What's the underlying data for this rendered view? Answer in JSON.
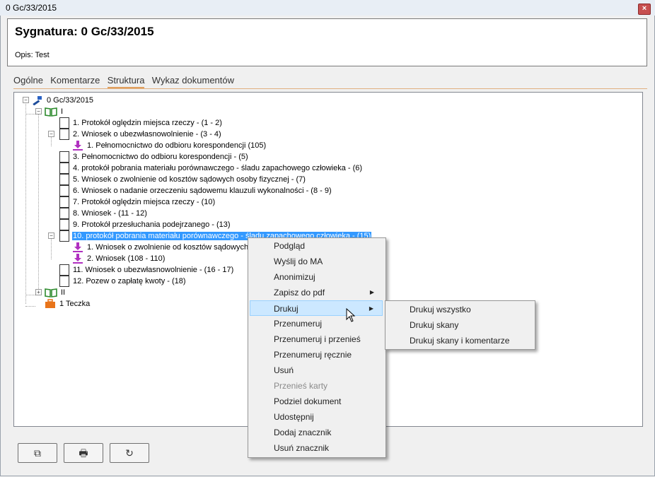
{
  "window": {
    "title": "0 Gc/33/2015",
    "close_label": "×"
  },
  "header": {
    "signature": "Sygnatura: 0 Gc/33/2015",
    "description": "Opis: Test"
  },
  "tabs": [
    {
      "label": "Ogólne"
    },
    {
      "label": "Komentarze"
    },
    {
      "label": "Struktura"
    },
    {
      "label": "Wykaz dokumentów"
    }
  ],
  "active_tab": "Struktura",
  "tree": {
    "root": "0 Gc/33/2015",
    "nodes": [
      {
        "text": "I"
      },
      {
        "text": "1. Protokół oględzin miejsca rzeczy -  (1 - 2)"
      },
      {
        "text": "2. Wniosek o ubezwłasnowolnienie -  (3 - 4)"
      },
      {
        "text": "1. Pełnomocnictwo do odbioru korespondencji (105)"
      },
      {
        "text": "3. Pełnomocnictwo do odbioru korespondencji -  (5)"
      },
      {
        "text": "4. protokół pobrania materiału porównawczego - śladu zapachowego człowieka -  (6)"
      },
      {
        "text": "5. Wniosek o zwolnienie od kosztów sądowych osoby fizycznej -  (7)"
      },
      {
        "text": "6. Wniosek o nadanie orzeczeniu sądowemu klauzuli wykonalności -  (8 - 9)"
      },
      {
        "text": "7. Protokół oględzin miejsca rzeczy -  (10)"
      },
      {
        "text": "8. Wniosek -  (11 - 12)"
      },
      {
        "text": "9. Protokół przesłuchania podejrzanego -  (13)"
      },
      {
        "text": "10. protokół pobrania materiału porównawczego - śladu zapachowego człowieka -  (15)"
      },
      {
        "text": "1. Wniosek o zwolnienie od kosztów sądowych osoby fizycznej"
      },
      {
        "text": "2. Wniosek (108 - 110)"
      },
      {
        "text": "11. Wniosek o ubezwłasnowolnienie -  (16 - 17)"
      },
      {
        "text": "12. Pozew o zapłatę kwoty -  (18)"
      },
      {
        "text": "II"
      },
      {
        "text": "1 Teczka"
      }
    ]
  },
  "context_menu": {
    "items": [
      {
        "label": "Podgląd"
      },
      {
        "label": "Wyślij do MA"
      },
      {
        "label": "Anonimizuj"
      },
      {
        "label": "Zapisz do pdf",
        "submenu": true
      },
      {
        "label": "Drukuj",
        "submenu": true,
        "highlighted": true
      },
      {
        "label": "Przenumeruj"
      },
      {
        "label": "Przenumeruj i przenieś"
      },
      {
        "label": "Przenumeruj ręcznie"
      },
      {
        "label": "Usuń"
      },
      {
        "label": "Przenieś karty",
        "disabled": true
      },
      {
        "label": "Podziel dokument"
      },
      {
        "label": "Udostępnij"
      },
      {
        "label": "Dodaj znacznik"
      },
      {
        "label": "Usuń znacznik"
      }
    ]
  },
  "submenu": {
    "items": [
      {
        "label": "Drukuj wszystko"
      },
      {
        "label": "Drukuj skany"
      },
      {
        "label": "Drukuj skany i komentarze"
      }
    ]
  },
  "bottom_buttons": [
    {
      "icon": "copy-icon",
      "glyph": "⧉"
    },
    {
      "icon": "print-icon",
      "glyph": "🖶"
    },
    {
      "icon": "refresh-icon",
      "glyph": "↻"
    }
  ],
  "colors": {
    "selection": "#3399ff",
    "menu_highlight": "#cce8ff",
    "book_green": "#2e8b2e",
    "download_purple": "#b030c0",
    "briefcase_orange": "#e8741a"
  }
}
